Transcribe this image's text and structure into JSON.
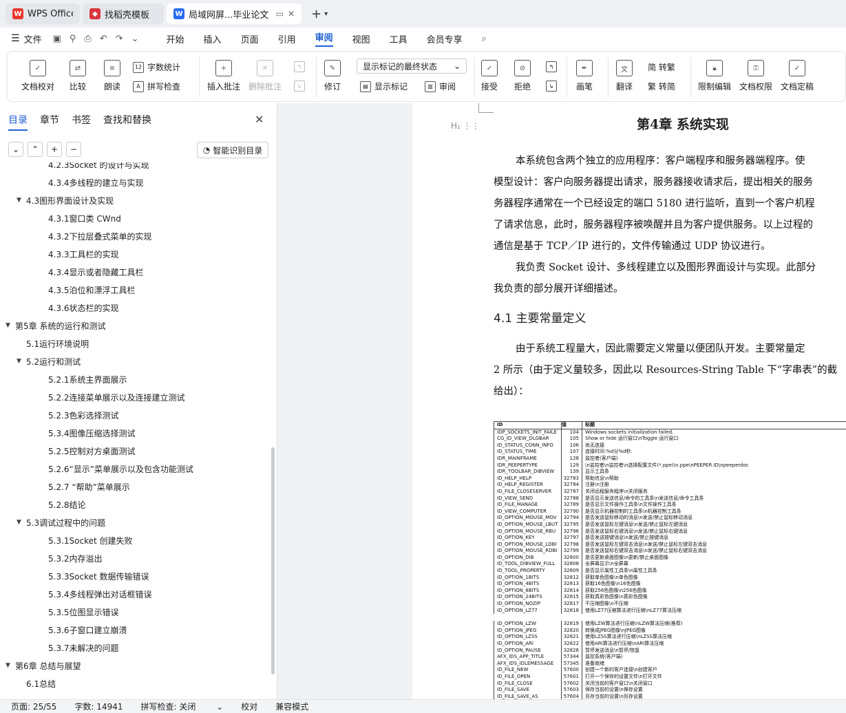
{
  "tabs": [
    {
      "title": "WPS Office",
      "icon": "wps-logo-icon"
    },
    {
      "title": "找稻壳模板",
      "icon": "docer-logo-icon"
    },
    {
      "title": "局域网屏...毕业论文",
      "icon": "writer-logo-icon"
    }
  ],
  "menu": {
    "file": "文件",
    "items": [
      "开始",
      "插入",
      "页面",
      "引用",
      "审阅",
      "视图",
      "工具",
      "会员专享"
    ],
    "active": "审阅"
  },
  "ribbon": {
    "doc_proof": "文档校对",
    "compare": "比较",
    "read_aloud": "朗读",
    "word_count": "字数统计",
    "spell_check": "拼写检查",
    "insert_comment": "插入批注",
    "delete_comment": "删除批注",
    "track": "修订",
    "markup_state": "显示标记的最终状态",
    "show_markup": "显示标记",
    "review": "审阅",
    "accept": "接受",
    "reject": "拒绝",
    "pen": "画笔",
    "translate": "翻译",
    "trad": "繁 转简",
    "simp": "简 转繁",
    "restrict": "限制编辑",
    "permission": "文档权限",
    "finalize": "文档定稿"
  },
  "panel": {
    "tabs": [
      "目录",
      "章节",
      "书签",
      "查找和替换"
    ],
    "smart_btn": "智能识别目录",
    "toc": [
      {
        "text": "4.2.3Socket 的设计与实现",
        "level": 3
      },
      {
        "text": "4.3.4多线程的建立与实现",
        "level": 3
      },
      {
        "text": "4.3图形界面设计及实现",
        "level": 2,
        "expand": true
      },
      {
        "text": "4.3.1窗口类 CWnd",
        "level": 3
      },
      {
        "text": "4.3.2下拉层叠式菜单的实现",
        "level": 3
      },
      {
        "text": "4.3.3工具栏的实现",
        "level": 3
      },
      {
        "text": "4.3.4显示或者隐藏工具栏",
        "level": 3
      },
      {
        "text": "4.3.5泊位和漂浮工具栏",
        "level": 3
      },
      {
        "text": "4.3.6状态栏的实现",
        "level": 3
      },
      {
        "text": "第5章 系统的运行和测试",
        "level": 1,
        "expand": true
      },
      {
        "text": "5.1运行环境说明",
        "level": 2
      },
      {
        "text": "5.2运行和测试",
        "level": 2,
        "expand": true
      },
      {
        "text": "5.2.1系统主界面展示",
        "level": 3
      },
      {
        "text": "5.2.2连接菜单展示以及连接建立测试",
        "level": 3
      },
      {
        "text": "5.2.3色彩选择测试",
        "level": 3
      },
      {
        "text": "5.3.4图像压缩选择测试",
        "level": 3
      },
      {
        "text": "5.2.5控制对方桌面测试",
        "level": 3
      },
      {
        "text": "5.2.6“显示”菜单展示以及包含功能测试",
        "level": 3
      },
      {
        "text": "5.2.7 “帮助”菜单展示",
        "level": 3
      },
      {
        "text": "5.2.8结论",
        "level": 3
      },
      {
        "text": "5.3调试过程中的问题",
        "level": 2,
        "expand": true
      },
      {
        "text": "5.3.1Socket 创建失败",
        "level": 3
      },
      {
        "text": "5.3.2内存溢出",
        "level": 3
      },
      {
        "text": "5.3.3Socket 数据传输错误",
        "level": 3
      },
      {
        "text": "5.3.4多线程弹出对话框错误",
        "level": 3
      },
      {
        "text": "5.3.5位图显示错误",
        "level": 3
      },
      {
        "text": "5.3.6子窗口建立崩溃",
        "level": 3
      },
      {
        "text": "5.3.7未解决的问题",
        "level": 3
      },
      {
        "text": "第6章 总结与展望",
        "level": 1,
        "expand": true
      },
      {
        "text": "6.1总结",
        "level": 2
      }
    ]
  },
  "doc": {
    "chapter_title": "第4章 系统实现",
    "heading_marker": "H₁",
    "paragraphs": [
      "本系统包含两个独立的应用程序：客户端程序和服务器端程序。使",
      "模型设计：客户向服务器提出请求，服务器接收请求后，提出相关的服务",
      "务器程序通常在一个已经设定的端口 5180 进行监听，直到一个客户机程",
      "了请求信息，此时，服务器程序被唤醒并且为客户提供服务。以上过程的",
      "通信是基于 TCP／IP 进行的，文件传输通过 UDP 协议进行。",
      "我负责 Socket 设计、多线程建立以及图形界面设计与实现。此部分",
      "我负责的部分展开详细描述。"
    ],
    "section_heading": "4.1 主要常量定义",
    "paragraphs2": [
      "由于系统工程量大，因此需要定义常量以便团队开发。主要常量定",
      "2 所示（由于定义量较多，因此以 Resources-String Table 下“字串表”的截",
      "给出）："
    ],
    "table": {
      "headers": [
        "ID",
        "值",
        "标题"
      ],
      "rows1": [
        [
          "IDP_SOCKETS_INIT_FAILE",
          "104",
          "Windows sockets initialization failed."
        ],
        [
          "CG_ID_VIEW_DLGBAR",
          "105",
          "Show or hide 运行窗口\\nToggle 运行窗口"
        ],
        [
          "ID_STATUS_CONN_INFO",
          "106",
          "尚无连接"
        ],
        [
          "ID_STATUS_TIME",
          "107",
          "连接时间:%d分%d秒."
        ],
        [
          "IDR_MAINFRAME",
          "128",
          "监控者(客户端)"
        ],
        [
          "IDR_PEEPERTYPE",
          "129",
          "\\n监控者\\n监控者\\n选择配置文件(*.ppe)\\n.ppe\\nPEEPER.ID\\npeeperdoc"
        ],
        [
          "IDR_TOOLBAR_DIBVIEW",
          "139",
          "显示工具条"
        ],
        [
          "ID_HELP_HELP",
          "32783",
          "帮助信息\\n帮助"
        ],
        [
          "ID_HELP_REGISTER",
          "32784",
          "注册\\n注册"
        ],
        [
          "ID_FILE_CLOSESERVER",
          "32787",
          "关闭远程服务程序\\n关闭服务"
        ],
        [
          "ID_VIEW_SEND",
          "32788",
          "是否显示发送信息/命令的工具条\\n发送信息/命令工具条"
        ],
        [
          "ID_FILE_MANAGE",
          "32789",
          "是否显示文件操作工具条\\n文件操作工具条"
        ],
        [
          "ID_VIEW_COMPUTER",
          "32790",
          "是否显示机器控制的工具条\\n机器控制工具条"
        ],
        [
          "ID_OPTION_MOUSE_MOV",
          "32794",
          "是否发送鼠标移动的消息\\n发送/禁止鼠标移动消息"
        ],
        [
          "ID_OPTION_MOUSE_LBUT",
          "32795",
          "是否发送鼠标左键消息\\n发送/禁止鼠标左键消息"
        ],
        [
          "ID_OPTION_MOUSE_RBU",
          "32796",
          "是否发送鼠标右键消息\\n发送/禁止鼠标右键消息"
        ],
        [
          "ID_OPTION_KEY",
          "32797",
          "是否发送按键消息\\n发送/禁止按键消息"
        ],
        [
          "ID_OPTION_MOUSE_LDBI",
          "32798",
          "是否发送鼠标左键双击消息\\n发送/禁止鼠标左键双击消息"
        ],
        [
          "ID_OPTION_MOUSE_RDBI",
          "32799",
          "是否发送鼠标右键双击消息\\n发送/禁止鼠标右键双击消息"
        ],
        [
          "ID_OPTION_DIB",
          "32800",
          "是否更新桌面图像\\n更新/禁止桌面图像"
        ],
        [
          "ID_TOOL_DIBVIEW_FULL",
          "32808",
          "全屏幕显示\\n全屏幕"
        ],
        [
          "ID_TOOL_PROPERTY",
          "32809",
          "是否显示属性工具条\\n属性工具条"
        ],
        [
          "ID_OPTION_1BITS",
          "32812",
          "获取单色图像\\n单色图像"
        ],
        [
          "ID_OPTION_4BITS",
          "32813",
          "获取16色图像\\n16色图像"
        ],
        [
          "ID_OPTION_8BITS",
          "32814",
          "获取256色图像\\n256色图像"
        ],
        [
          "ID_OPTION_24BITS",
          "32815",
          "获取真彩色图像\\n真彩色图像"
        ],
        [
          "ID_OPTION_NOZIP",
          "32817",
          "不压缩图像\\n不压缩"
        ],
        [
          "ID_OPTION_LZ77",
          "32818",
          "使用LZ77压缩算法进行压缩\\nLZ77算法压缩"
        ]
      ],
      "rows2": [
        [
          "ID_OPTION_LZW",
          "32819",
          "使用LZW算法进行压缩\\nLZW算法压缩(推荐)"
        ],
        [
          "ID_OPTION_JPEG",
          "32820",
          "转换成JPEG图像\\nJPEG图像"
        ],
        [
          "ID_OPTION_LZSS",
          "32821",
          "使用LZSS算法进行压缩\\nLZSS算法压缩"
        ],
        [
          "ID_OPTION_ARI",
          "32822",
          "使用ARI算法进行压缩\\nARI算法压缩"
        ],
        [
          "ID_OPTION_PAUSE",
          "32826",
          "暂停发送消息\\n暂停/恢复"
        ],
        [
          "AFX_IDS_APP_TITLE",
          "57344",
          "监控系统(客户端)"
        ],
        [
          "AFX_IDS_IDLEMESSAGE",
          "57345",
          "准备就绪"
        ],
        [
          "ID_FILE_NEW",
          "57600",
          "创建一个新的客户连接\\n创建客户"
        ],
        [
          "ID_FILE_OPEN",
          "57601",
          "打开一个保存的设置文件\\n打开文件"
        ],
        [
          "ID_FILE_CLOSE",
          "57602",
          "关闭当前的客户窗口\\n关闭窗口"
        ],
        [
          "ID_FILE_SAVE",
          "57603",
          "保存当前的设置\\n保存设置"
        ],
        [
          "ID_FILE_SAVE_AS",
          "57604",
          "另存当前的设置\\n另存设置"
        ]
      ]
    }
  },
  "status": {
    "page": "页面: 25/55",
    "words": "字数: 14941",
    "spell": "拼写检查: 关闭",
    "proof": "校对",
    "compat": "兼容模式"
  },
  "colors": {
    "accent": "#1f5fd1",
    "wps_red": "#e8382c",
    "writer_blue": "#2a6df4"
  }
}
